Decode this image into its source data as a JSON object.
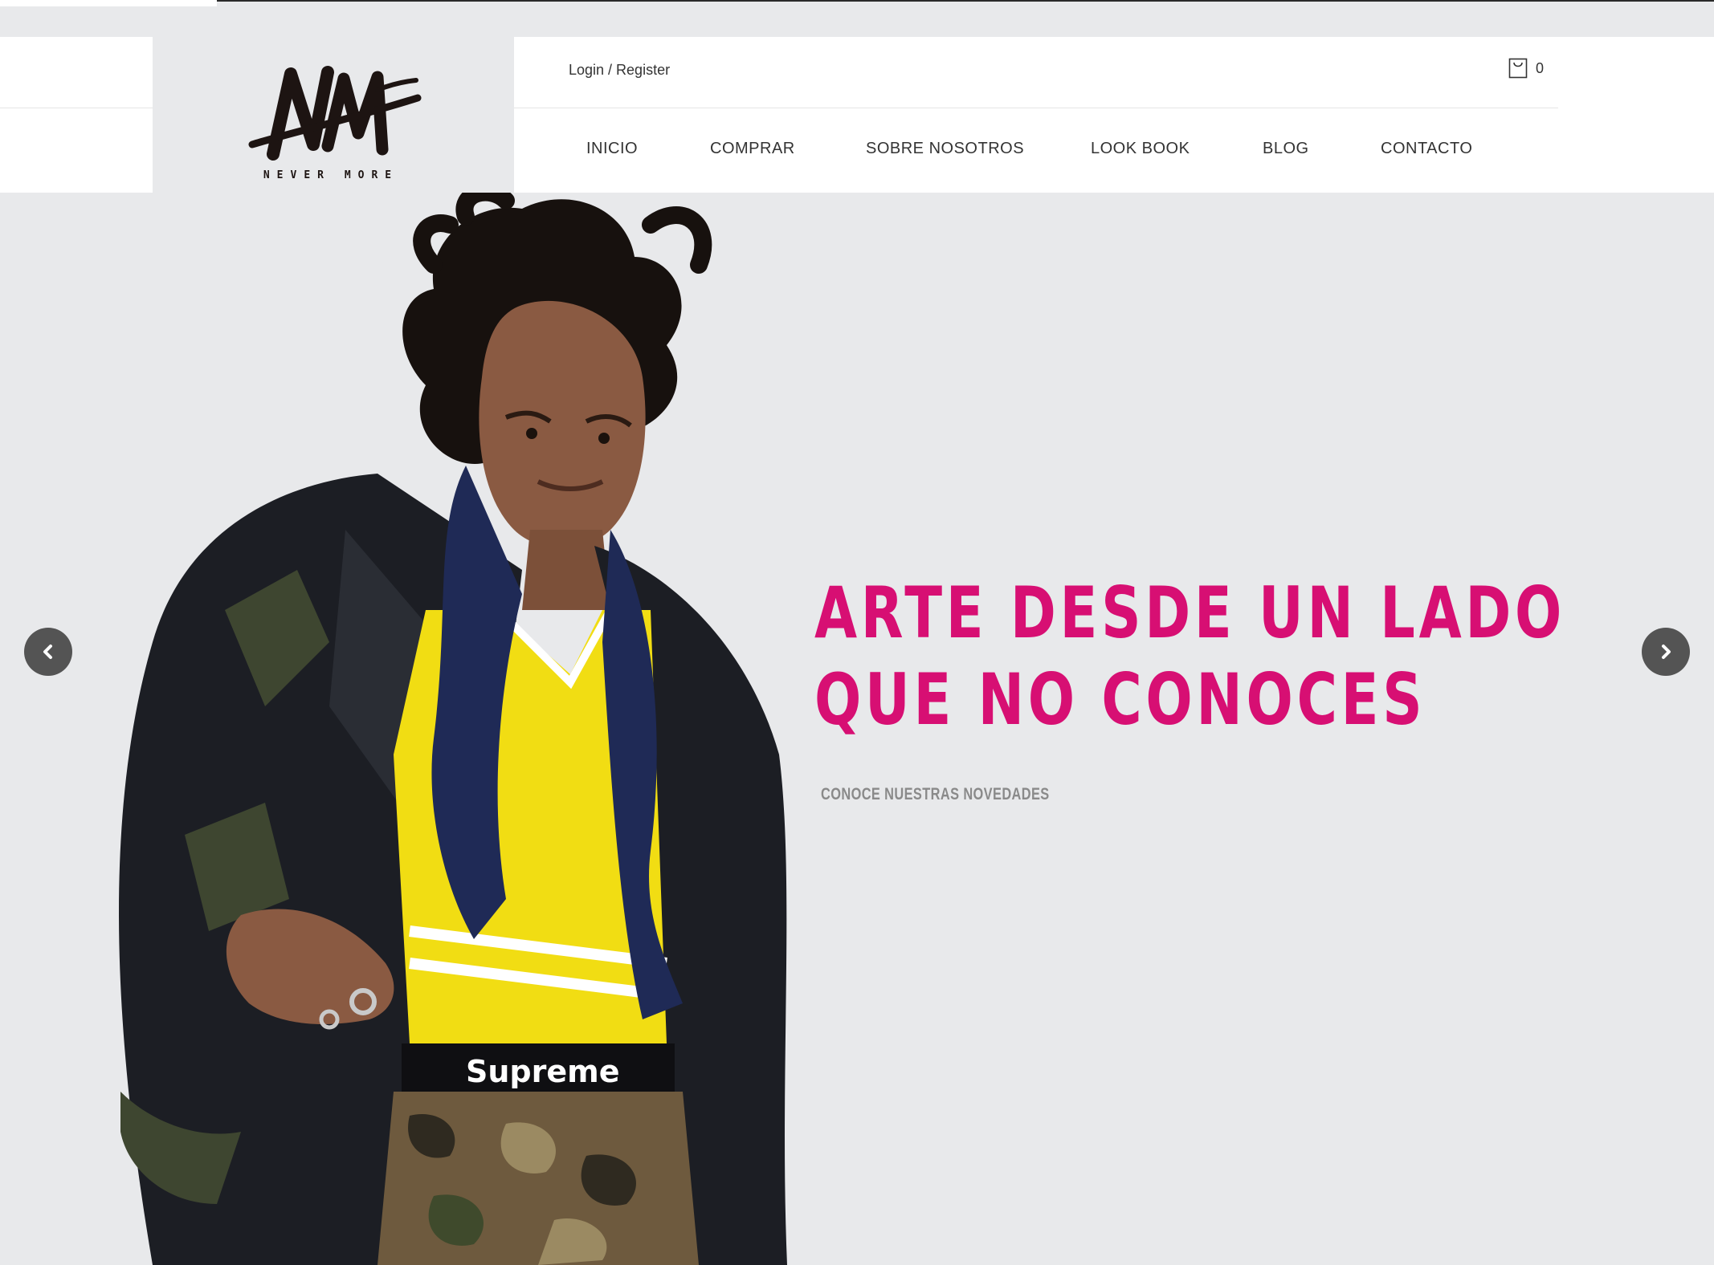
{
  "header": {
    "login_label": "Login / Register",
    "cart_count": "0",
    "logo_text": "NEVER MORE",
    "logo_mark": "NM",
    "nav": [
      {
        "label": "INICIO"
      },
      {
        "label": "COMPRAR"
      },
      {
        "label": "SOBRE NOSOTROS"
      },
      {
        "label": "LOOK BOOK"
      },
      {
        "label": "BLOG"
      },
      {
        "label": "CONTACTO"
      }
    ]
  },
  "hero": {
    "headline_line1": "ARTE DESDE UN LADO",
    "headline_line2": "QUE NO CONOCES",
    "subtext": "CONOCE NUESTRAS NOVEDADES",
    "accent_color": "#d70f73",
    "background_color": "#e8e9eb",
    "image_description_icons": [
      "model-photo"
    ]
  },
  "slider": {
    "prev_icon": "chevron-left-icon",
    "next_icon": "chevron-right-icon"
  }
}
